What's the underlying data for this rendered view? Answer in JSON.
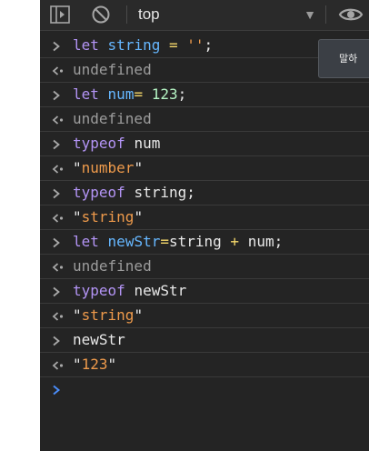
{
  "toolbar": {
    "context": "top",
    "icons": [
      "sidebar-toggle-icon",
      "clear-console-icon",
      "chevron-down-icon",
      "eye-icon"
    ]
  },
  "tooltip": {
    "text": "말하"
  },
  "log": [
    {
      "kind": "input",
      "parts": [
        [
          "let",
          "kw"
        ],
        [
          " ",
          "plain"
        ],
        [
          "string",
          "var"
        ],
        [
          " ",
          "plain"
        ],
        [
          "=",
          "op"
        ],
        [
          " ",
          "plain"
        ],
        [
          "''",
          "str"
        ],
        [
          ";",
          "plain"
        ]
      ]
    },
    {
      "kind": "output",
      "parts": [
        [
          "undefined",
          "und"
        ]
      ]
    },
    {
      "kind": "input",
      "parts": [
        [
          "let",
          "kw"
        ],
        [
          " ",
          "plain"
        ],
        [
          "num",
          "var"
        ],
        [
          "=",
          "op"
        ],
        [
          " ",
          "plain"
        ],
        [
          "123",
          "num"
        ],
        [
          ";",
          "plain"
        ]
      ]
    },
    {
      "kind": "output",
      "parts": [
        [
          "undefined",
          "und"
        ]
      ]
    },
    {
      "kind": "input",
      "parts": [
        [
          "typeof",
          "kw"
        ],
        [
          " ",
          "plain"
        ],
        [
          "num",
          "plain"
        ]
      ]
    },
    {
      "kind": "output",
      "parts": [
        [
          "\"",
          "quote"
        ],
        [
          "number",
          "str"
        ],
        [
          "\"",
          "quote"
        ]
      ]
    },
    {
      "kind": "input",
      "parts": [
        [
          "typeof",
          "kw"
        ],
        [
          " ",
          "plain"
        ],
        [
          "string;",
          "plain"
        ]
      ]
    },
    {
      "kind": "output",
      "parts": [
        [
          "\"",
          "quote"
        ],
        [
          "string",
          "str"
        ],
        [
          "\"",
          "quote"
        ]
      ]
    },
    {
      "kind": "input",
      "parts": [
        [
          "let",
          "kw"
        ],
        [
          " ",
          "plain"
        ],
        [
          "newStr",
          "var"
        ],
        [
          "=",
          "op"
        ],
        [
          "string",
          "plain"
        ],
        [
          " ",
          "plain"
        ],
        [
          "+",
          "op"
        ],
        [
          " ",
          "plain"
        ],
        [
          "num;",
          "plain"
        ]
      ]
    },
    {
      "kind": "output",
      "parts": [
        [
          "undefined",
          "und"
        ]
      ]
    },
    {
      "kind": "input",
      "parts": [
        [
          "typeof",
          "kw"
        ],
        [
          " ",
          "plain"
        ],
        [
          "newStr",
          "plain"
        ]
      ]
    },
    {
      "kind": "output",
      "parts": [
        [
          "\"",
          "quote"
        ],
        [
          "string",
          "str"
        ],
        [
          "\"",
          "quote"
        ]
      ]
    },
    {
      "kind": "input",
      "parts": [
        [
          "newStr",
          "plain"
        ]
      ]
    },
    {
      "kind": "output",
      "parts": [
        [
          "\"",
          "quote"
        ],
        [
          "123",
          "str"
        ],
        [
          "\"",
          "quote"
        ]
      ]
    }
  ],
  "colors": {
    "background": "#242424",
    "keyword": "#b394f5",
    "variable": "#66b7ff",
    "string": "#ee9a4b",
    "number": "#b5f5c4",
    "operator": "#f6d96b",
    "muted": "#9c9c9c",
    "prompt": "#4a8cf7"
  }
}
